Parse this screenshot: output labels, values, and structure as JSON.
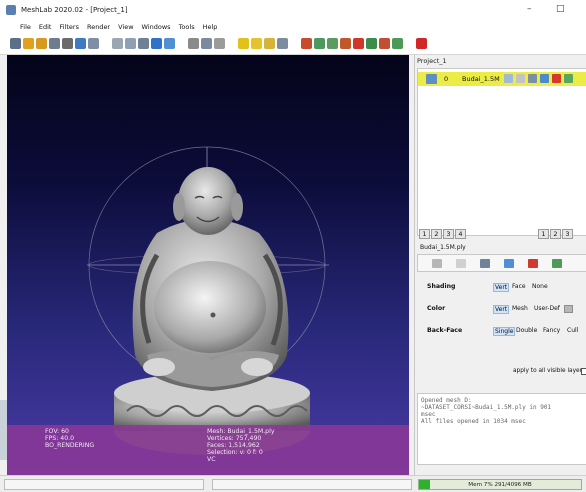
{
  "window": {
    "title": "MeshLab 2020.02 - [Project_1]",
    "minimize_icon": "minimize-icon",
    "maximize_icon": "maximize-icon"
  },
  "menu": {
    "items": [
      "File",
      "Edit",
      "Filters",
      "Render",
      "View",
      "Windows",
      "Tools",
      "Help"
    ]
  },
  "toolbar": {
    "icons": [
      {
        "name": "new-project-icon",
        "color": "#5b6f86"
      },
      {
        "name": "open-icon",
        "color": "#e1a020"
      },
      {
        "name": "import-mesh-icon",
        "color": "#d79a1f"
      },
      {
        "name": "reload-icon",
        "color": "#6d7c8f"
      },
      {
        "name": "export-icon",
        "color": "#6b6b6b"
      },
      {
        "name": "snapshot-icon",
        "color": "#3c7bc2"
      },
      {
        "name": "bbox-icon",
        "color": "#7d8ea6"
      },
      {
        "name": "points-icon",
        "color": "#9aa6b3"
      },
      {
        "name": "wireframe-icon",
        "color": "#8ea0b3"
      },
      {
        "name": "flat-lines-icon",
        "color": "#6f8198"
      },
      {
        "name": "flat-icon",
        "color": "#2f73c8"
      },
      {
        "name": "smooth-icon",
        "color": "#4f8fd6"
      },
      {
        "name": "lighting-icon",
        "color": "#8a8a8a"
      },
      {
        "name": "backface-icon",
        "color": "#7a8ba0"
      },
      {
        "name": "color-icon",
        "color": "#9b9b9b"
      },
      {
        "name": "info-icon",
        "color": "#e0c21a"
      },
      {
        "name": "measure-icon",
        "color": "#e3c42a"
      },
      {
        "name": "paint-icon",
        "color": "#d8b33a"
      },
      {
        "name": "select-icon",
        "color": "#7c8c9e"
      },
      {
        "name": "edit-tool-1-icon",
        "color": "#c94b2d"
      },
      {
        "name": "edit-tool-2-icon",
        "color": "#4c9a5d"
      },
      {
        "name": "edit-tool-3-icon",
        "color": "#5a9c60"
      },
      {
        "name": "edit-tool-4-icon",
        "color": "#c2572c"
      },
      {
        "name": "edit-tool-5-icon",
        "color": "#d1362a"
      },
      {
        "name": "edit-tool-6-icon",
        "color": "#3c8c4a"
      },
      {
        "name": "edit-tool-7-icon",
        "color": "#c24e33"
      },
      {
        "name": "edit-tool-8-icon",
        "color": "#4d9a56"
      },
      {
        "name": "delete-icon",
        "color": "#d22727"
      }
    ]
  },
  "viewport": {
    "info_left": [
      "FOV: 60",
      "FPS:   40.0",
      "BO_RENDERING"
    ],
    "info_right": [
      "Mesh: Budai_1.5M.ply",
      "Vertices: 757,490",
      "Faces: 1,514,962",
      "Selection: v: 0 f: 0",
      "VC"
    ]
  },
  "panel": {
    "title": "Project_1",
    "layer": {
      "index": "0",
      "name": "Budai_1.5M"
    },
    "tabs_left": [
      "1",
      "2",
      "3",
      "4"
    ],
    "tabs_right": [
      "1",
      "2",
      "3"
    ],
    "mesh_file": "Budai_1.5M.ply",
    "options": [
      {
        "label": "Shading",
        "values": [
          "Vert",
          "Face",
          "None"
        ],
        "selected": "Vert"
      },
      {
        "label": "Color",
        "values": [
          "Vert",
          "Mesh",
          "User-Def"
        ],
        "selected": "Vert"
      },
      {
        "label": "Back-Face",
        "values": [
          "Single",
          "Double",
          "Fancy",
          "Cull"
        ],
        "selected": "Single"
      }
    ],
    "apply_label": "apply to all visible layers",
    "log": [
      "Opened mesh D:",
      "~DATASET_CORSI~Budai_1.5M.ply in 901",
      "msec",
      "All files opened in 1034 msec"
    ]
  },
  "status": {
    "memory": "Mem 7% 291/4096 MB",
    "memory_fraction": 0.07
  }
}
